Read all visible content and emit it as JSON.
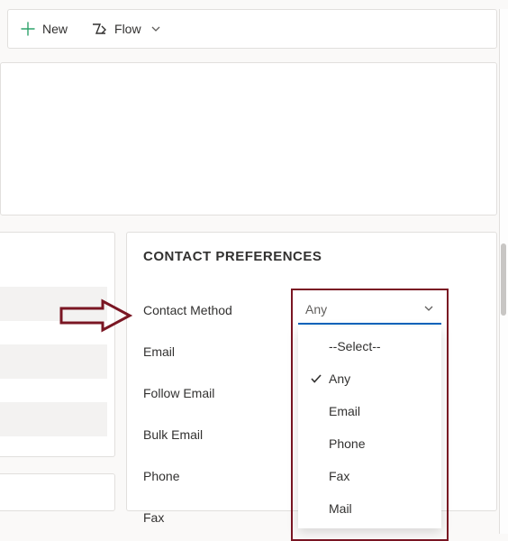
{
  "toolbar": {
    "new_label": "New",
    "flow_label": "Flow"
  },
  "section": {
    "title": "CONTACT PREFERENCES"
  },
  "fields": {
    "contact_method": "Contact Method",
    "email": "Email",
    "follow_email": "Follow Email",
    "bulk_email": "Bulk Email",
    "phone": "Phone",
    "fax": "Fax"
  },
  "dropdown": {
    "selected": "Any",
    "options": {
      "placeholder": "--Select--",
      "any": "Any",
      "email": "Email",
      "phone": "Phone",
      "fax": "Fax",
      "mail": "Mail"
    }
  },
  "colors": {
    "accent": "#0564bd",
    "annotation": "#7a1623"
  }
}
